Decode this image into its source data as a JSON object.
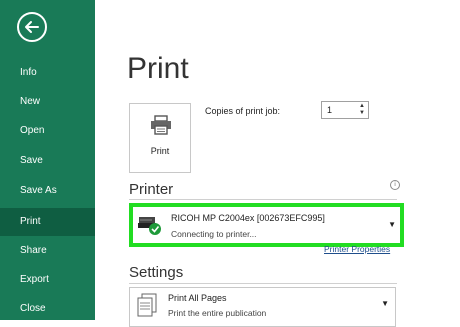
{
  "sidebar": {
    "items": [
      {
        "label": "Info"
      },
      {
        "label": "New"
      },
      {
        "label": "Open"
      },
      {
        "label": "Save"
      },
      {
        "label": "Save As"
      },
      {
        "label": "Print",
        "active": true
      },
      {
        "label": "Share"
      },
      {
        "label": "Export"
      },
      {
        "label": "Close"
      }
    ]
  },
  "main": {
    "title": "Print",
    "print_button_label": "Print",
    "copies": {
      "label": "Copies of print job:",
      "value": "1"
    },
    "printer": {
      "section_title": "Printer",
      "name": "RICOH MP C2004ex [002673EFC995]",
      "status": "Connecting to printer...",
      "properties_link": "Printer Properties"
    },
    "settings": {
      "section_title": "Settings",
      "pages_option": "Print All Pages",
      "pages_description": "Print the entire publication"
    }
  },
  "colors": {
    "sidebar_bg": "#197a57",
    "sidebar_active": "#0f5e42",
    "highlight": "#22dd22",
    "link": "#1f4e8c"
  }
}
